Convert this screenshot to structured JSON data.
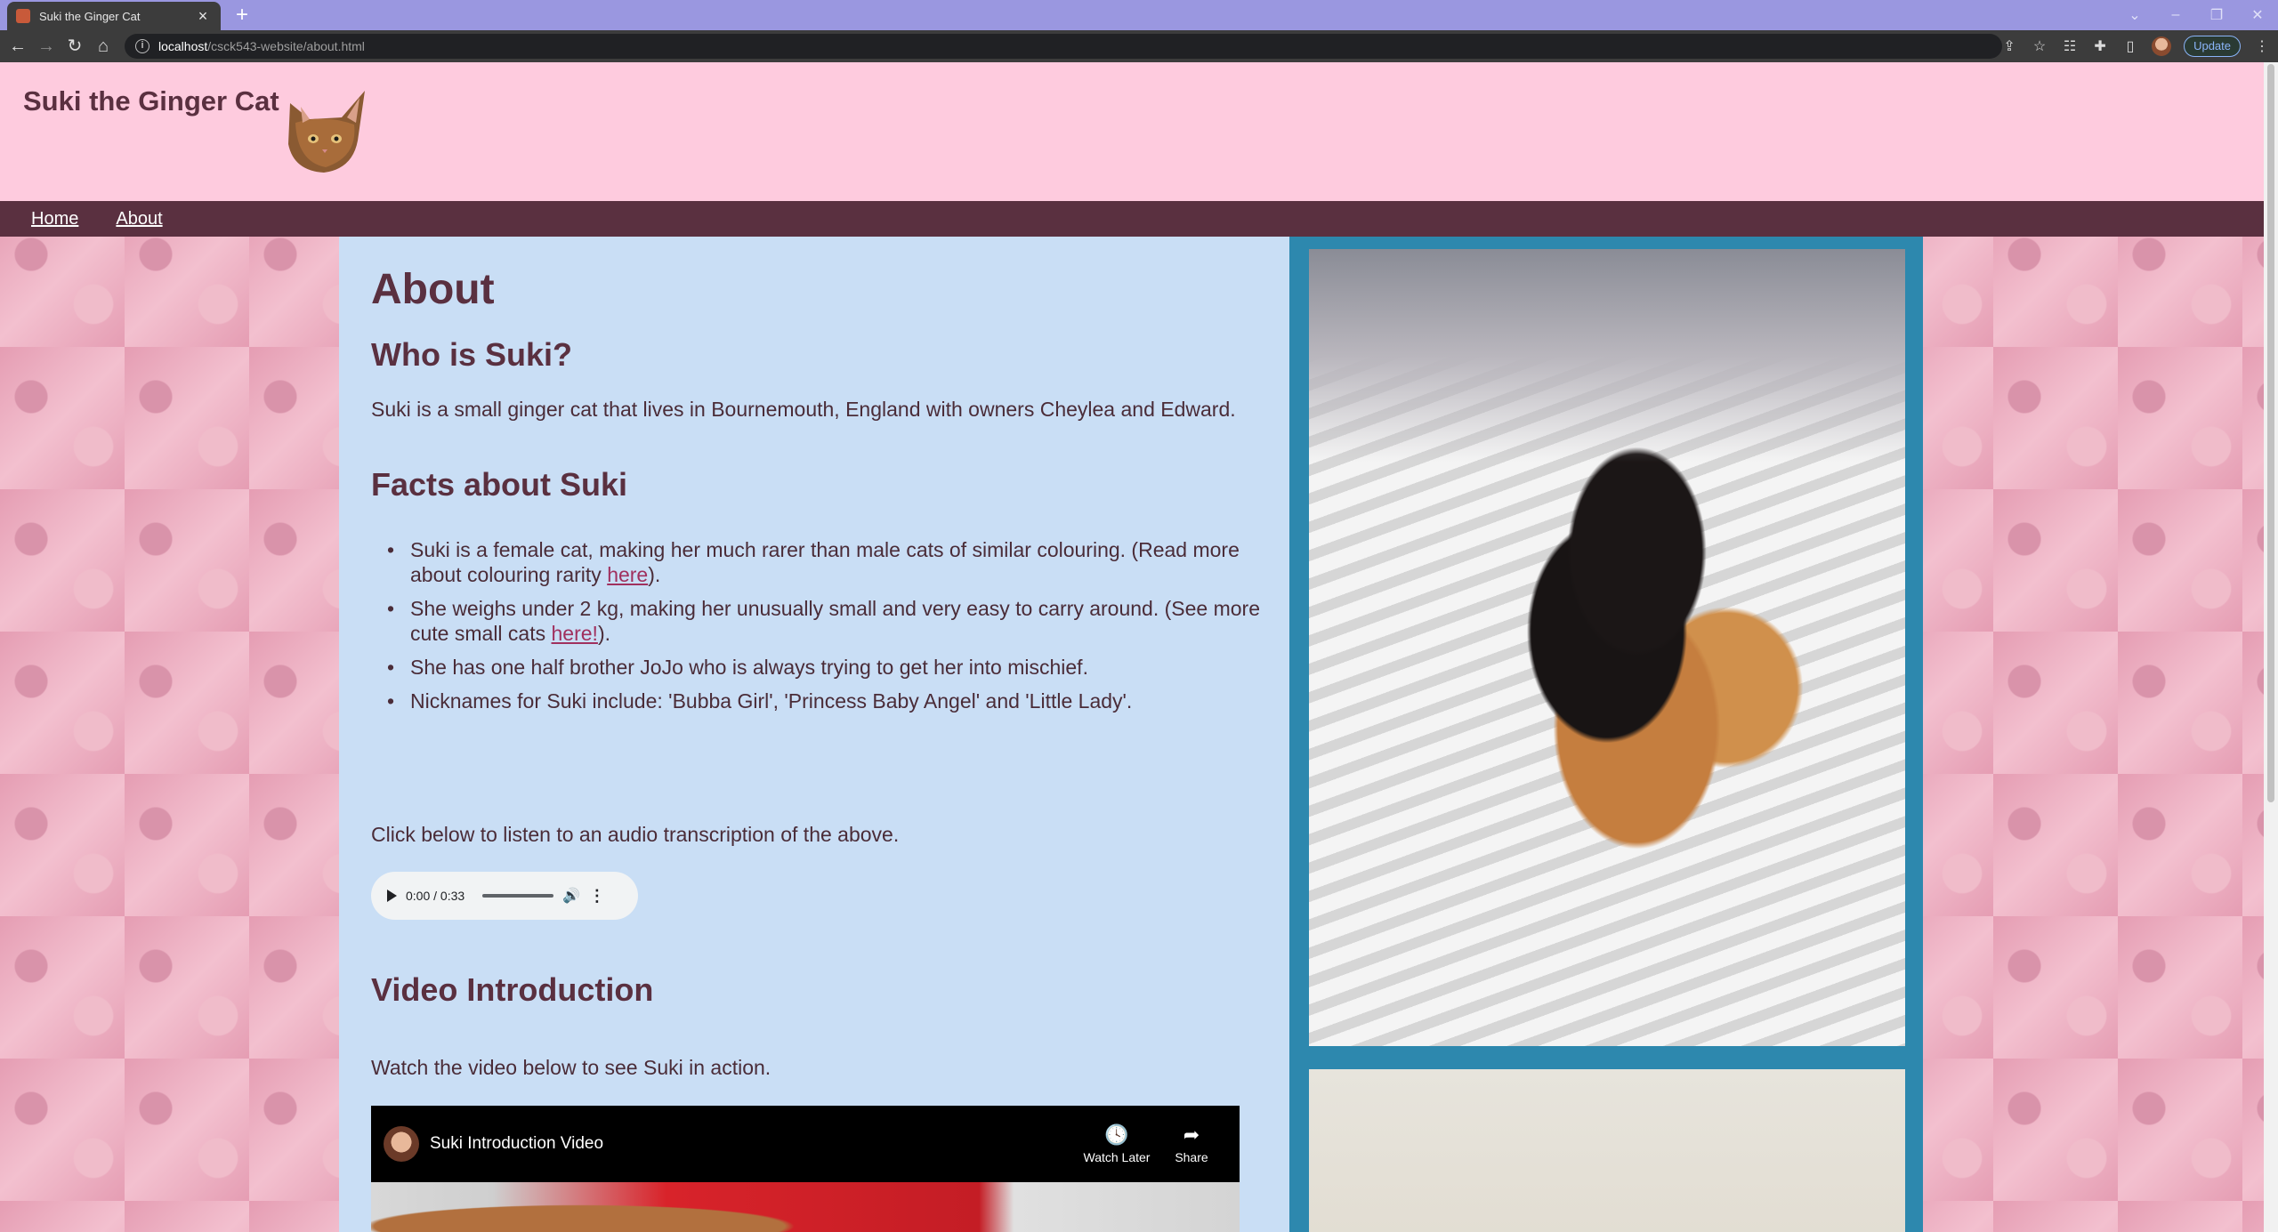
{
  "browser": {
    "tab_title": "Suki the Ginger Cat",
    "tab_close": "×",
    "new_tab": "+",
    "url_host": "localhost",
    "url_path": "/csck543-website/about.html",
    "update_label": "Update",
    "icons": [
      "back-icon",
      "forward-icon",
      "reload-icon",
      "home-icon",
      "info-icon",
      "share-icon",
      "star-icon",
      "reading-list-icon",
      "extensions-icon",
      "side-panel-icon",
      "profile-avatar",
      "menu-icon"
    ]
  },
  "site": {
    "title": "Suki the Ginger Cat",
    "nav": [
      {
        "label": "Home"
      },
      {
        "label": "About"
      }
    ]
  },
  "about": {
    "heading": "About",
    "who_heading": "Who is Suki?",
    "who_text": "Suki is a small ginger cat that lives in Bournemouth, England with owners Cheylea and Edward.",
    "facts_heading": "Facts about Suki",
    "facts": {
      "f1_before": "Suki is a female cat, making her much rarer than male cats of similar colouring. (Read more about colouring rarity ",
      "f1_link": "here",
      "f1_after": ").",
      "f2_before": "She weighs under 2 kg, making her unusually small and very easy to carry around. (See more cute small cats ",
      "f2_link": "here!",
      "f2_after": ").",
      "f3": "She has one half brother JoJo who is always trying to get her into mischief.",
      "f4": "Nicknames for Suki include: 'Bubba Girl', 'Princess Baby Angel' and 'Little Lady'."
    },
    "audio_prompt": "Click below to listen to an audio transcription of the above.",
    "audio_time": "0:00 / 0:33",
    "video_heading": "Video Introduction",
    "video_prompt": "Watch the video below to see Suki in action.",
    "video_title": "Suki Introduction Video",
    "watch_later": "Watch Later",
    "share": "Share"
  }
}
